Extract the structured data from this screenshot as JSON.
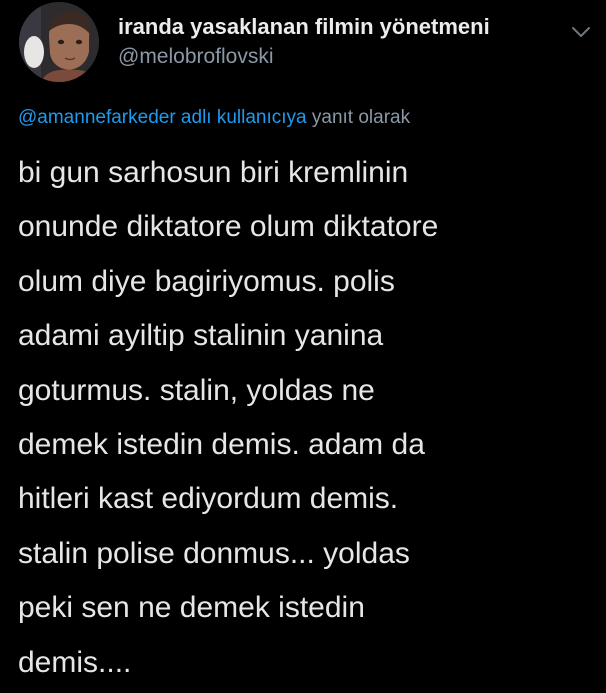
{
  "tweet": {
    "display_name": "iranda yasaklanan filmin yönetmeni",
    "handle": "@melobroflovski",
    "reply": {
      "user": "@amannefarkeder adlı kullanıcıya",
      "suffix": "yanıt olarak"
    },
    "body_lines": [
      "bi gun sarhosun biri kremlinin",
      "onunde diktatore olum diktatore",
      "olum diye bagiriyomus. polis",
      "adami ayiltip stalinin yanina",
      "goturmus. stalin, yoldas ne",
      "demek istedin demis. adam da",
      "hitleri kast ediyordum demis.",
      "stalin polise donmus... yoldas",
      "peki sen ne demek istedin",
      "demis...."
    ]
  },
  "icons": {
    "avatar": "profile-photo",
    "more": "chevron-down-icon"
  },
  "colors": {
    "background": "#000000",
    "text": "#e6e6e6",
    "secondary": "#8b98a5",
    "link": "#1d9bf0"
  }
}
